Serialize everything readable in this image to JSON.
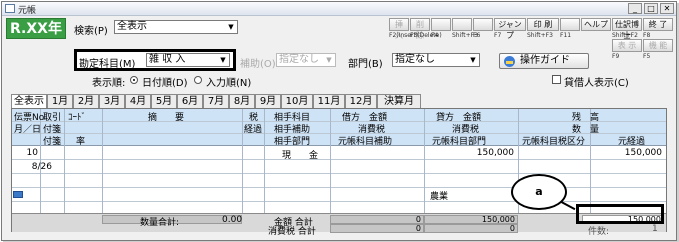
{
  "window": {
    "title": "元帳"
  },
  "header": {
    "year_badge": "R.XX年",
    "search_label": "検索(P)",
    "search_value": "全表示",
    "fkeys": [
      {
        "top": "挿 入",
        "sub": "F2(Insert)",
        "dim": true
      },
      {
        "top": "削 除",
        "sub": "F3(Delete)",
        "dim": true
      },
      {
        "top": "",
        "sub": "F4",
        "dim": true
      },
      {
        "top": "",
        "sub": "Shift+F3",
        "dim": true
      },
      {
        "top": "",
        "sub": "F6",
        "dim": true
      },
      {
        "top": "ジャンプ",
        "sub": "F7",
        "dim": false
      },
      {
        "top": "印 刷",
        "sub": "Shift+F3",
        "dim": false
      },
      {
        "top": "",
        "sub": "F11",
        "dim": true
      },
      {
        "top": "ヘルプ",
        "sub": "",
        "dim": false
      },
      {
        "top": "仕訳博士",
        "sub": "Shift+F2",
        "dim": false
      },
      {
        "top": "終 了",
        "sub": "F8",
        "dim": false
      }
    ],
    "fkeys_row2": [
      {
        "top": "表 示",
        "sub": "F9",
        "dim": true
      },
      {
        "top": "機 能",
        "sub": "F5",
        "dim": true
      }
    ]
  },
  "filters": {
    "kamoku_label": "勘定科目(M)",
    "kamoku_value": "雑 収 入",
    "hojo_label": "補助(O)",
    "hojo_value": "指定なし",
    "bumon_label": "部門(B)",
    "bumon_value": "指定なし",
    "guide_button": "操作ガイド",
    "order_label": "表示順:",
    "order_date": "日付順(D)",
    "order_input": "入力順(N)",
    "lender_label": "貸借人表示(C)"
  },
  "tabs": [
    "全表示",
    "1月",
    "2月",
    "3月",
    "4月",
    "5月",
    "6月",
    "7月",
    "8月",
    "9月",
    "10月",
    "11月",
    "12月",
    "決算月"
  ],
  "table": {
    "headers": {
      "c1a": "伝票No",
      "c1b": "月／日",
      "c2a": "取引",
      "c2b": "付箋",
      "c2c": "付箋",
      "c3a": "ｺｰﾄﾞ",
      "c3c": "率",
      "c4": "摘　　要",
      "c5a": "税",
      "c5b": "経過",
      "c6a": "相手科目",
      "c6b": "相手補助",
      "c6c": "相手部門",
      "c7a": "借方　金額",
      "c7b": "消費税",
      "c7c": "元帳科目補助",
      "c8a": "貸方　金額",
      "c8b": "消費税",
      "c8c": "元帳科目部門",
      "c9a": "残　高",
      "c9b": "数　量",
      "c9c": "元帳科目税区分",
      "c9d": "元経過"
    },
    "rows": [
      {
        "no": "10",
        "date": "8/26",
        "aite": "現　　金",
        "kashikata": "150,000",
        "zandaka": "150,000",
        "bumon": "農業"
      }
    ]
  },
  "footer": {
    "qty_label": "数量合計:",
    "qty_value": "0.00",
    "amount_label": "金額 合計",
    "tax_label": "消費税 合計",
    "debit_total": "0",
    "credit_total": "150,000",
    "balance_total": "150,000",
    "debit_tax": "0",
    "credit_tax": "0",
    "bottom_right": "件数:",
    "bottom_right_value": "1"
  },
  "callout": {
    "label": "a"
  }
}
